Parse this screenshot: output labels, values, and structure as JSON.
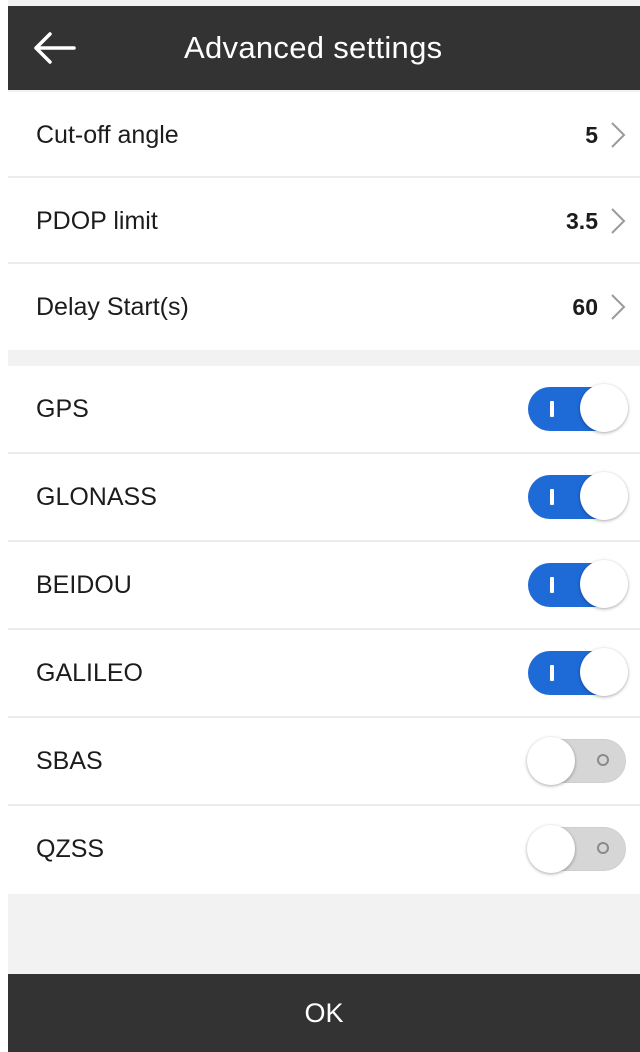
{
  "header": {
    "title": "Advanced settings",
    "back_icon": "arrow-left-icon"
  },
  "params": [
    {
      "label": "Cut-off angle",
      "value": "5"
    },
    {
      "label": "PDOP limit",
      "value": "3.5"
    },
    {
      "label": "Delay Start(s)",
      "value": "60"
    }
  ],
  "systems": [
    {
      "label": "GPS",
      "enabled": true
    },
    {
      "label": "GLONASS",
      "enabled": true
    },
    {
      "label": "BEIDOU",
      "enabled": true
    },
    {
      "label": "GALILEO",
      "enabled": true
    },
    {
      "label": "SBAS",
      "enabled": false
    },
    {
      "label": "QZSS",
      "enabled": false
    }
  ],
  "footer": {
    "ok_label": "OK"
  },
  "colors": {
    "bar": "#333333",
    "toggle_on": "#1e6ad6",
    "toggle_off": "#d6d6d6",
    "background": "#f2f2f2"
  }
}
